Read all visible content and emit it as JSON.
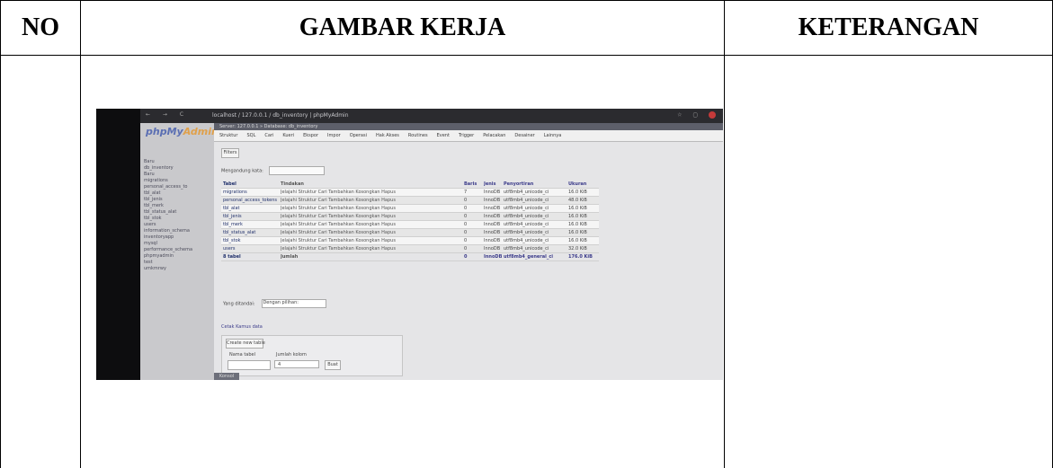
{
  "headers": {
    "no": "NO",
    "gambar_kerja": "GAMBAR KERJA",
    "keterangan": "KETERANGAN"
  },
  "screenshot": {
    "browser_url": "localhost / 127.0.0.1 / db_inventory | phpMyAdmin",
    "logo_main": "phpMy",
    "logo_accent": "Admin",
    "breadcrumb": "Server: 127.0.0.1 » Database: db_inventory",
    "tabs": [
      "Struktur",
      "SQL",
      "Cari",
      "Kueri",
      "Ekspor",
      "Impor",
      "Operasi",
      "Hak Akses",
      "Routines",
      "Event",
      "Trigger",
      "Pelacakan",
      "Desainer",
      "Lainnya"
    ],
    "sidebar": [
      "Baru",
      "db_inventory",
      "Baru",
      "migrations",
      "personal_access_to",
      "tbl_alat",
      "tbl_jenis",
      "tbl_merk",
      "tbl_status_alat",
      "tbl_stok",
      "users",
      "information_schema",
      "inventoryapp",
      "mysql",
      "performance_schema",
      "phpmyadmin",
      "test",
      "umkmrwy"
    ],
    "filters_label": "Filters",
    "containing_label": "Mengandung kata:",
    "table": {
      "headers": [
        "Tabel",
        "Tindakan",
        "Baris",
        "Jenis",
        "Penyortiran",
        "Ukuran"
      ],
      "rows": [
        {
          "name": "migrations",
          "actions": "Jelajahi  Struktur  Cari  Tambahkan  Kosongkan  Hapus",
          "rows": "7",
          "type": "InnoDB",
          "collation": "utf8mb4_unicode_ci",
          "size": "16.0 KiB"
        },
        {
          "name": "personal_access_tokens",
          "actions": "Jelajahi  Struktur  Cari  Tambahkan  Kosongkan  Hapus",
          "rows": "0",
          "type": "InnoDB",
          "collation": "utf8mb4_unicode_ci",
          "size": "48.0 KiB"
        },
        {
          "name": "tbl_alat",
          "actions": "Jelajahi  Struktur  Cari  Tambahkan  Kosongkan  Hapus",
          "rows": "0",
          "type": "InnoDB",
          "collation": "utf8mb4_unicode_ci",
          "size": "16.0 KiB"
        },
        {
          "name": "tbl_jenis",
          "actions": "Jelajahi  Struktur  Cari  Tambahkan  Kosongkan  Hapus",
          "rows": "0",
          "type": "InnoDB",
          "collation": "utf8mb4_unicode_ci",
          "size": "16.0 KiB"
        },
        {
          "name": "tbl_merk",
          "actions": "Jelajahi  Struktur  Cari  Tambahkan  Kosongkan  Hapus",
          "rows": "0",
          "type": "InnoDB",
          "collation": "utf8mb4_unicode_ci",
          "size": "16.0 KiB"
        },
        {
          "name": "tbl_status_alat",
          "actions": "Jelajahi  Struktur  Cari  Tambahkan  Kosongkan  Hapus",
          "rows": "0",
          "type": "InnoDB",
          "collation": "utf8mb4_unicode_ci",
          "size": "16.0 KiB"
        },
        {
          "name": "tbl_stok",
          "actions": "Jelajahi  Struktur  Cari  Tambahkan  Kosongkan  Hapus",
          "rows": "0",
          "type": "InnoDB",
          "collation": "utf8mb4_unicode_ci",
          "size": "16.0 KiB"
        },
        {
          "name": "users",
          "actions": "Jelajahi  Struktur  Cari  Tambahkan  Kosongkan  Hapus",
          "rows": "0",
          "type": "InnoDB",
          "collation": "utf8mb4_unicode_ci",
          "size": "32.0 KiB"
        }
      ],
      "summary": {
        "name": "8 tabel",
        "actions": "Jumlah",
        "rows": "0",
        "type": "InnoDB",
        "collation": "utf8mb4_general_ci",
        "size": "176.0 KiB"
      }
    },
    "with_selected_label": "Yang ditandai:",
    "with_selected_value": "Dengan pilihan:",
    "print_label": "Cetak  Kamus data",
    "create_table_button": "Create new table",
    "table_name_label": "Nama tabel",
    "columns_label": "Jumlah kolom",
    "columns_value": "4",
    "go_button": "Buat",
    "console_label": "Konsol"
  }
}
